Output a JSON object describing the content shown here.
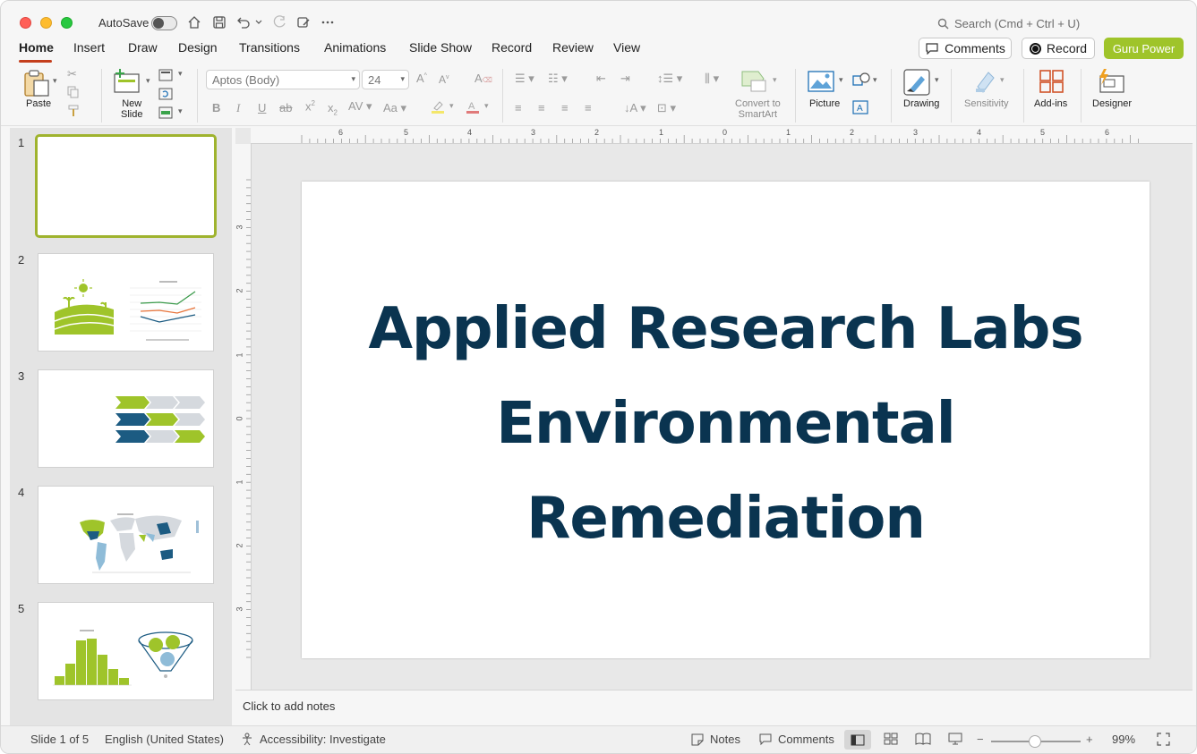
{
  "titlebar": {
    "autosave_label": "AutoSave",
    "search_placeholder": "Search (Cmd + Ctrl + U)"
  },
  "menu": {
    "tabs": [
      "Home",
      "Insert",
      "Draw",
      "Design",
      "Transitions",
      "Animations",
      "Slide Show",
      "Record",
      "Review",
      "View"
    ],
    "active_tab": "Home",
    "comments_label": "Comments",
    "record_label": "Record",
    "guru_label": "Guru Power"
  },
  "ribbon": {
    "paste_label": "Paste",
    "new_slide_label": "New\nSlide",
    "font_name": "Aptos (Body)",
    "font_size": "24",
    "convert_label": "Convert to\nSmartArt",
    "picture_label": "Picture",
    "drawing_label": "Drawing",
    "sensitivity_label": "Sensitivity",
    "addins_label": "Add-ins",
    "designer_label": "Designer"
  },
  "thumbnails": [
    {
      "num": "1"
    },
    {
      "num": "2"
    },
    {
      "num": "3"
    },
    {
      "num": "4"
    },
    {
      "num": "5"
    }
  ],
  "ruler": {
    "h_marks": [
      "6",
      "5",
      "4",
      "3",
      "2",
      "1",
      "0",
      "1",
      "2",
      "3",
      "4",
      "5",
      "6"
    ],
    "v_marks": [
      "3",
      "2",
      "1",
      "0",
      "1",
      "2",
      "3"
    ]
  },
  "slide": {
    "title": "Applied Research Labs Environmental Remediation"
  },
  "notes_placeholder": "Click to add notes",
  "status": {
    "slide_info": "Slide 1 of 5",
    "language": "English (United States)",
    "accessibility": "Accessibility: Investigate",
    "notes_label": "Notes",
    "comments_label": "Comments",
    "zoom": "99%"
  },
  "colors": {
    "accent": "#c43e1c",
    "guru": "#9fc42a",
    "title": "#0a3450",
    "thumb_green": "#9fc42a",
    "thumb_blue": "#1c5b82",
    "thumb_gray": "#d5d9de"
  }
}
